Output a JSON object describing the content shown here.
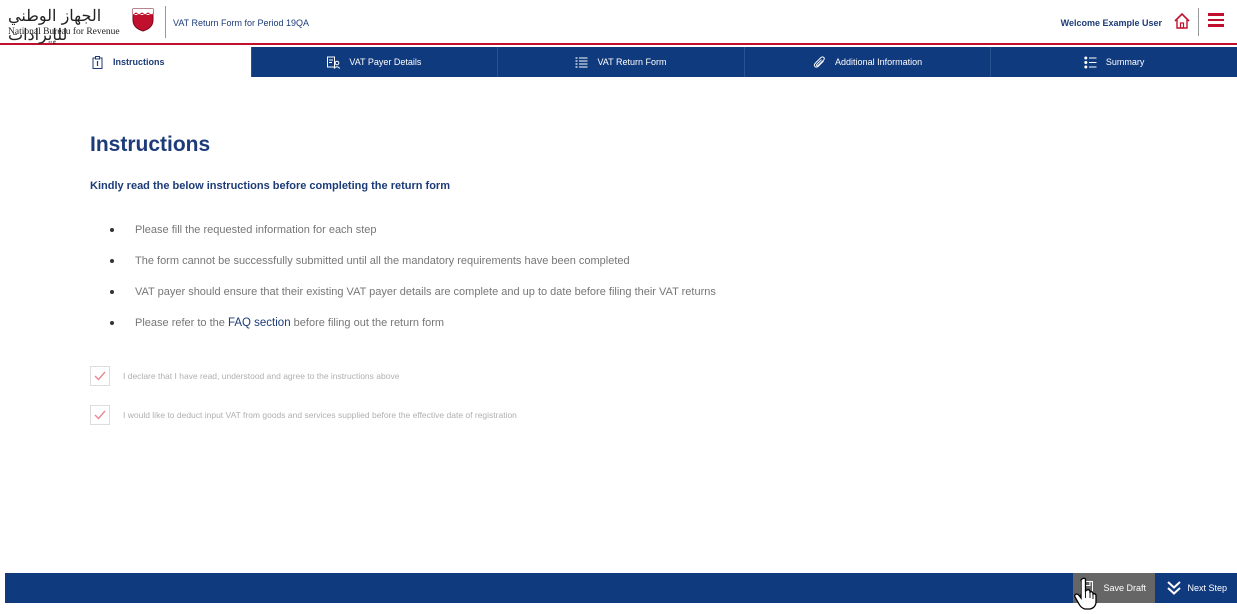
{
  "header": {
    "logo_arabic": "الجهاز الوطني للإيرادات",
    "logo_english": "National Bureau for Revenue",
    "title": "VAT Return Form for Period 19QA",
    "welcome": "Welcome Example User"
  },
  "tabs": [
    {
      "label": "Instructions",
      "icon": "clipboard-icon",
      "active": true
    },
    {
      "label": "VAT Payer Details",
      "icon": "user-details-icon",
      "active": false
    },
    {
      "label": "VAT Return Form",
      "icon": "list-icon",
      "active": false
    },
    {
      "label": "Additional Information",
      "icon": "paperclip-icon",
      "active": false
    },
    {
      "label": "Summary",
      "icon": "summary-list-icon",
      "active": false
    }
  ],
  "main": {
    "title": "Instructions",
    "subtitle": "Kindly read the below instructions before completing the return form",
    "instructions": [
      "Please fill the requested information for each step",
      "The form cannot be successfully submitted until all the mandatory requirements have been completed",
      "VAT payer should ensure that their existing VAT payer details are complete and up to date before filing their VAT returns"
    ],
    "faq_prefix": "Please refer to the",
    "faq_link": "FAQ section",
    "faq_suffix": "before filing out the return form",
    "checks": [
      {
        "label": "I declare that I have read, understood and agree to the instructions above",
        "checked": true
      },
      {
        "label": "I would like to deduct input VAT from goods and services supplied before the effective date of registration",
        "checked": true
      }
    ]
  },
  "footer": {
    "save_draft": "Save Draft",
    "next_step": "Next Step"
  },
  "colors": {
    "brand_blue": "#103a7e",
    "brand_red": "#c0102e",
    "text_blue": "#1c3b78",
    "save_gray": "#666666"
  }
}
